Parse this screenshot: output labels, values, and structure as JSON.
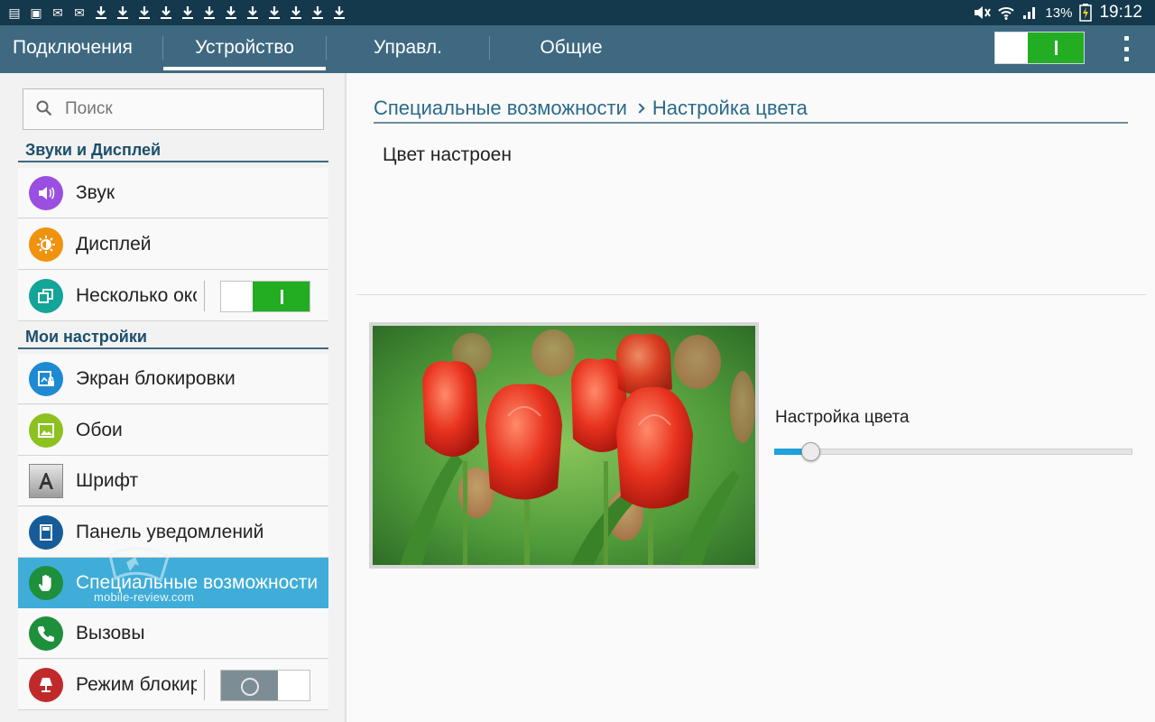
{
  "status_bar": {
    "left_icons": [
      "sim-icon",
      "image-icon",
      "mail-icon",
      "mail-alert-icon",
      "download-icon",
      "download-icon",
      "download-icon",
      "download-icon",
      "download-icon",
      "download-icon",
      "download-icon",
      "download-icon",
      "download-icon",
      "download-icon",
      "download-icon",
      "download-icon"
    ],
    "battery": "13%",
    "time": "19:12"
  },
  "tabs": [
    {
      "label": "Подключения",
      "active": false
    },
    {
      "label": "Устройство",
      "active": true
    },
    {
      "label": "Управл.",
      "active": false
    },
    {
      "label": "Общие",
      "active": false
    }
  ],
  "master_toggle": {
    "state": "on"
  },
  "search": {
    "placeholder": "Поиск"
  },
  "sidebar": {
    "sections": [
      {
        "title": "Звуки и Дисплей"
      },
      {
        "title": "Мои настройки"
      }
    ],
    "items": [
      {
        "label": "Звук",
        "icon": "speaker-icon",
        "color": "#9b4fe0"
      },
      {
        "label": "Дисплей",
        "icon": "brightness-icon",
        "color": "#f0920c"
      },
      {
        "label": "Несколько окон",
        "icon": "multi-window-icon",
        "color": "#13a49a",
        "toggle": "on"
      },
      {
        "label": "Экран блокировки",
        "icon": "lock-screen-icon",
        "color": "#1d8ad3"
      },
      {
        "label": "Обои",
        "icon": "wallpaper-icon",
        "color": "#8cc121"
      },
      {
        "label": "Шрифт",
        "icon": "font-icon",
        "color": "#8a8a8a"
      },
      {
        "label": "Панель уведомлений",
        "icon": "notification-panel-icon",
        "color": "#165c99"
      },
      {
        "label": "Специальные возможности",
        "icon": "hand-icon",
        "color": "#1e8f3b",
        "selected": true
      },
      {
        "label": "Вызовы",
        "icon": "phone-icon",
        "color": "#1e8f3b"
      },
      {
        "label": "Режим блокировки",
        "icon": "lamp-icon",
        "color": "#c02a2a",
        "toggle": "off"
      }
    ]
  },
  "watermark": "mobile-review.com",
  "breadcrumb": {
    "parent": "Специальные возможности",
    "current": "Настройка цвета"
  },
  "status_text": "Цвет настроен",
  "slider": {
    "label": "Настройка цвета",
    "value_fraction": 0.1
  },
  "colors": {
    "accent": "#1fa2db",
    "selected_row": "#3fadd8",
    "tabbar": "#3e6981",
    "statusbar": "#14384c",
    "toggle_on": "#22ad22"
  }
}
